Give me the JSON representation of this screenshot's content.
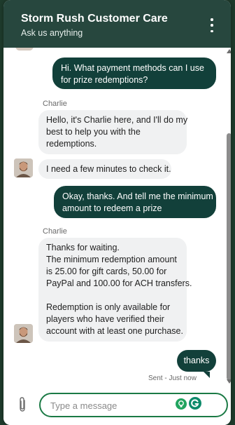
{
  "header": {
    "title": "Storm Rush Customer Care",
    "subtitle": "Ask us anything"
  },
  "messages": [
    {
      "direction": "outgoing",
      "lines": [
        "Hi. What payment methods can I use",
        "for prize redemptions?"
      ]
    },
    {
      "direction": "incoming",
      "sender": "Charlie",
      "lines": [
        "Hello, it's Charlie here, and I'll do my",
        "best to help you with the",
        "redemptions."
      ]
    },
    {
      "direction": "incoming",
      "lines": [
        "I need a few minutes to check it."
      ]
    },
    {
      "direction": "outgoing",
      "lines": [
        "Okay, thanks. And tell me the minimum",
        "amount to redeem a prize"
      ]
    },
    {
      "direction": "incoming",
      "sender": "Charlie",
      "lines": [
        "Thanks for waiting.",
        "The minimum redemption amount",
        "is 25.00 for gift cards, 50.00 for",
        "PayPal and 100.00 for ACH transfers.",
        "",
        "Redemption is only available for",
        "players who have verified their",
        "account with at least one purchase."
      ]
    },
    {
      "direction": "outgoing",
      "lines": [
        "thanks"
      ]
    }
  ],
  "status": {
    "sent": "Sent - Just now"
  },
  "composer": {
    "placeholder": "Type a message"
  },
  "icons": {
    "menu": "kebab-menu-icon",
    "attach": "paperclip-icon",
    "hint": "lightbulb-icon",
    "grammarly": "grammarly-icon"
  },
  "colors": {
    "header": "#27473e",
    "outgoing_bubble": "#12403a",
    "incoming_bubble": "#f0f1f2",
    "input_border": "#1b7a45",
    "page_background": "#1e3b2c"
  }
}
